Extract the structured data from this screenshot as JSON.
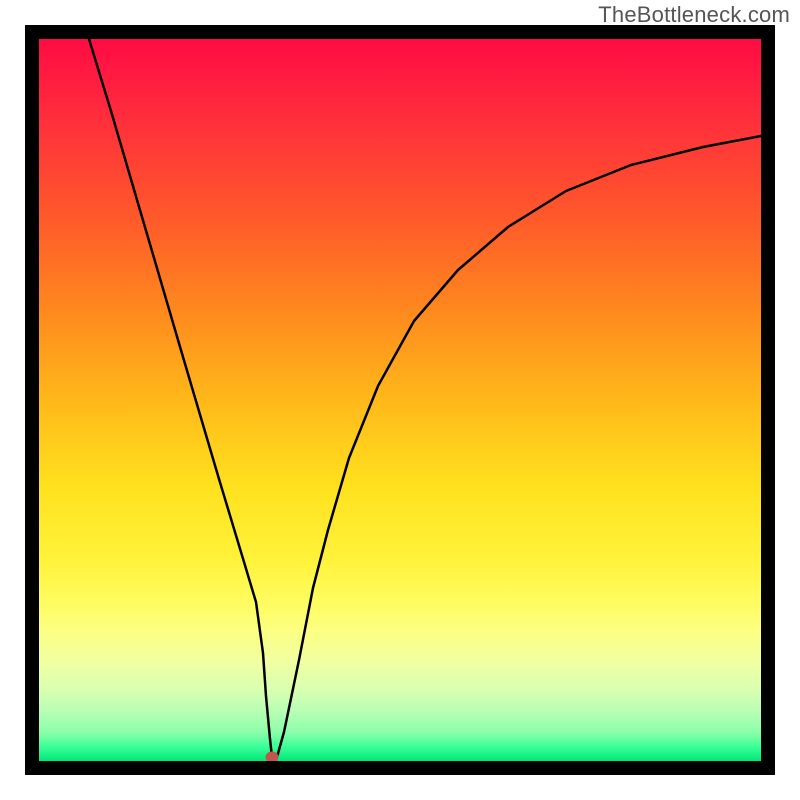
{
  "watermark": {
    "text": "TheBottleneck.com"
  },
  "chart_data": {
    "type": "line",
    "title": "",
    "xlabel": "",
    "ylabel": "",
    "xlim": [
      0,
      100
    ],
    "ylim": [
      0,
      100
    ],
    "grid": false,
    "legend": false,
    "series": [
      {
        "name": "bottleneck-curve",
        "x": [
          7,
          10,
          15,
          20,
          25,
          28,
          30,
          31,
          31.5,
          32,
          32.3,
          33,
          34,
          36,
          38,
          40,
          43,
          47,
          52,
          58,
          65,
          73,
          82,
          92,
          100
        ],
        "y": [
          100,
          90,
          73,
          56,
          39,
          29,
          22,
          15,
          9,
          3,
          0.5,
          0.5,
          4,
          14,
          24,
          32,
          42,
          52,
          61,
          68,
          74,
          79,
          82.5,
          85,
          86.5
        ]
      }
    ],
    "markers": [
      {
        "name": "optimal-point",
        "x": 32.3,
        "y": 0.5,
        "color": "#c2554d"
      }
    ],
    "gradient_stops": [
      {
        "pos": 0.0,
        "color": "#ff0b44"
      },
      {
        "pos": 0.5,
        "color": "#ffe11e"
      },
      {
        "pos": 1.0,
        "color": "#00e878"
      }
    ]
  }
}
